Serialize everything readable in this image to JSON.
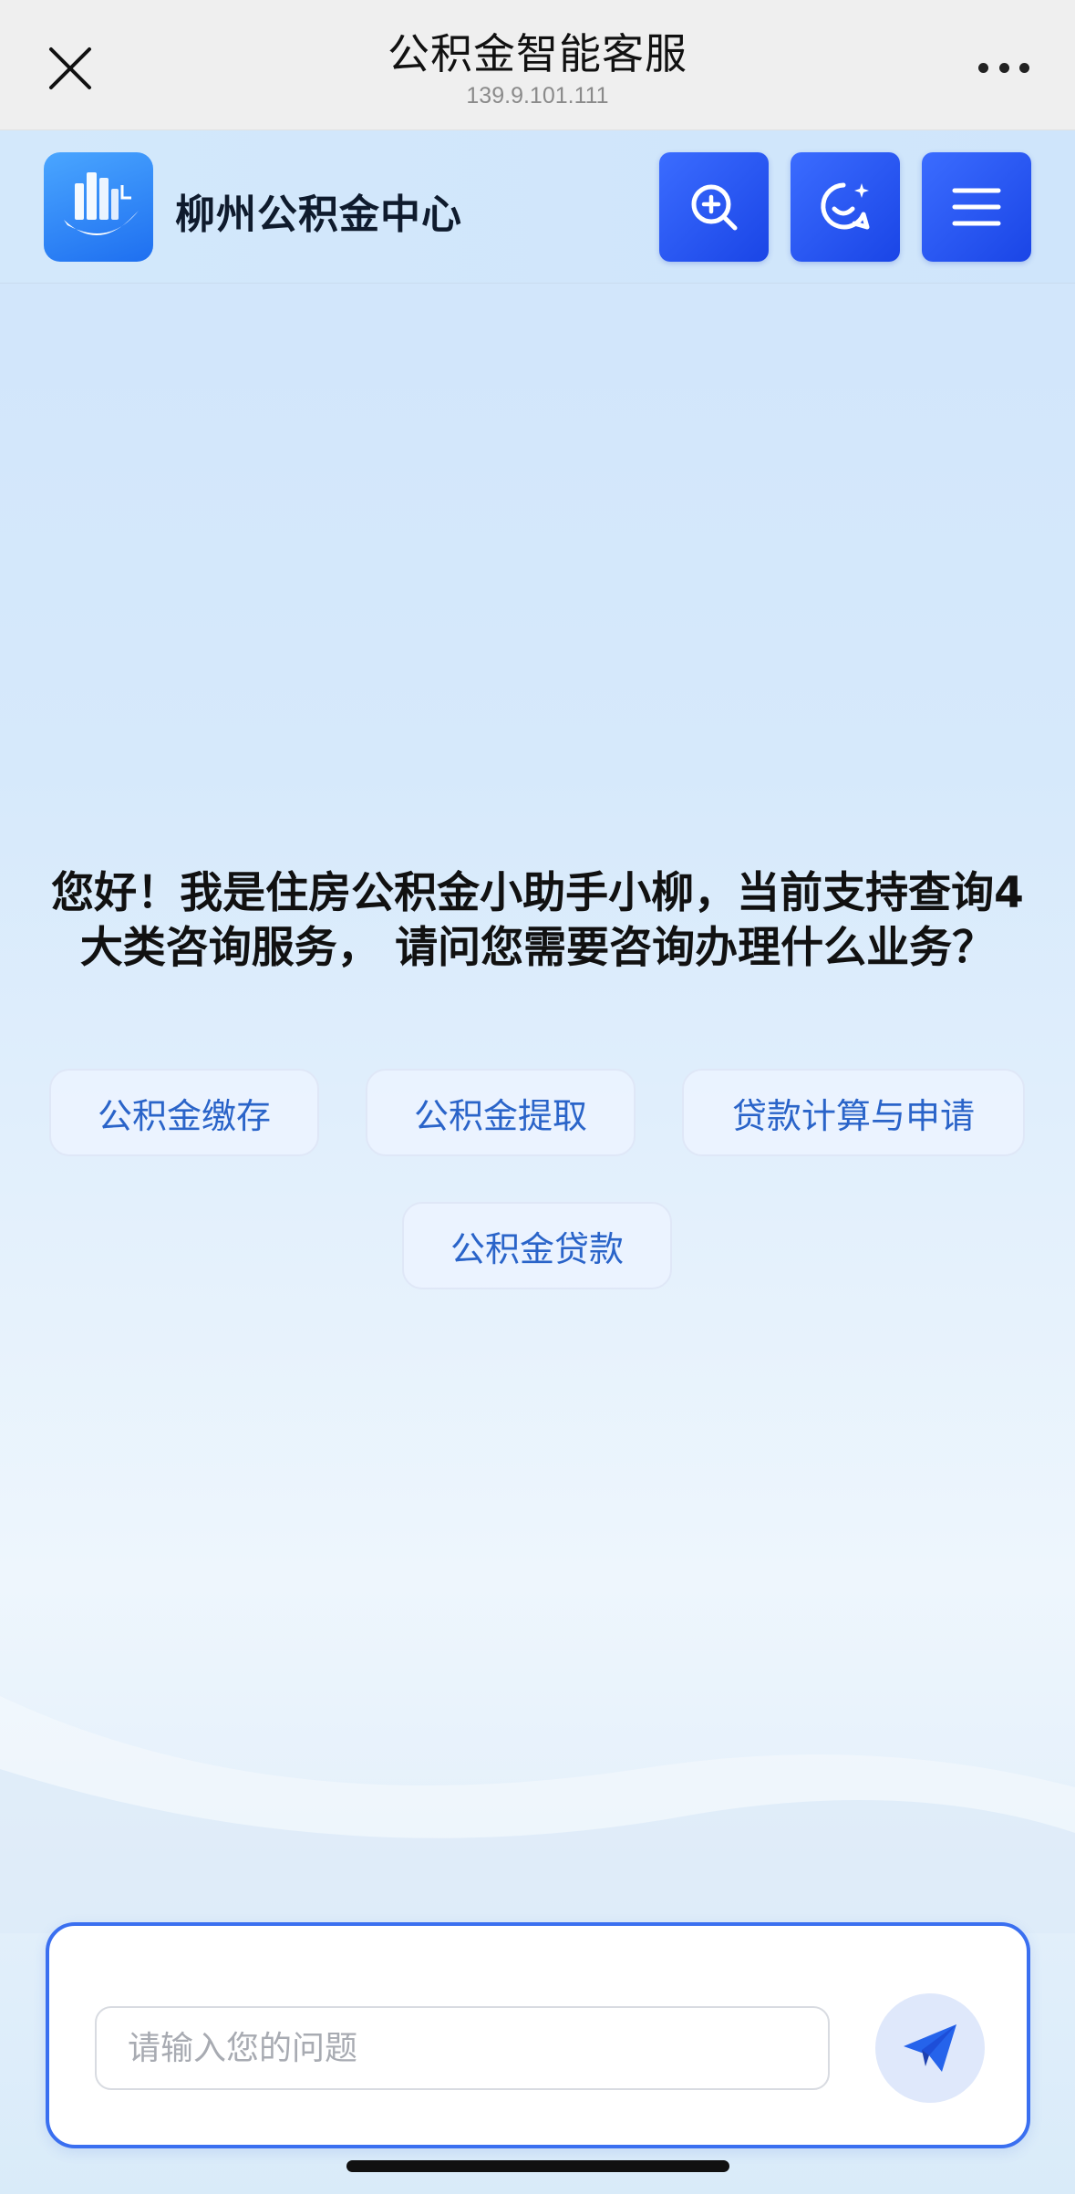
{
  "topbar": {
    "title": "公积金智能客服",
    "address": "139.9.101.111",
    "icons": {
      "close": "close-icon",
      "more": "more-dots-icon"
    }
  },
  "header": {
    "org_name": "柳州公积金中心",
    "buttons": [
      {
        "name": "search",
        "icon": "zoom-search-icon"
      },
      {
        "name": "chat",
        "icon": "chat-smile-icon"
      },
      {
        "name": "menu",
        "icon": "hamburger-menu-icon"
      }
    ]
  },
  "chat": {
    "greeting": "您好！我是住房公积金小助手小柳，当前支持查询4大类咨询服务， 请问您需要咨询办理什么业务？",
    "quick_replies": [
      "公积金缴存",
      "公积金提取",
      "贷款计算与申请",
      "公积金贷款"
    ]
  },
  "input": {
    "placeholder": "请输入您的问题",
    "value": "",
    "send_icon": "send-paper-plane-icon"
  },
  "colors": {
    "accent": "#1f4ff0",
    "chip_text": "#2a64c9",
    "input_border": "#3a6ff0"
  }
}
